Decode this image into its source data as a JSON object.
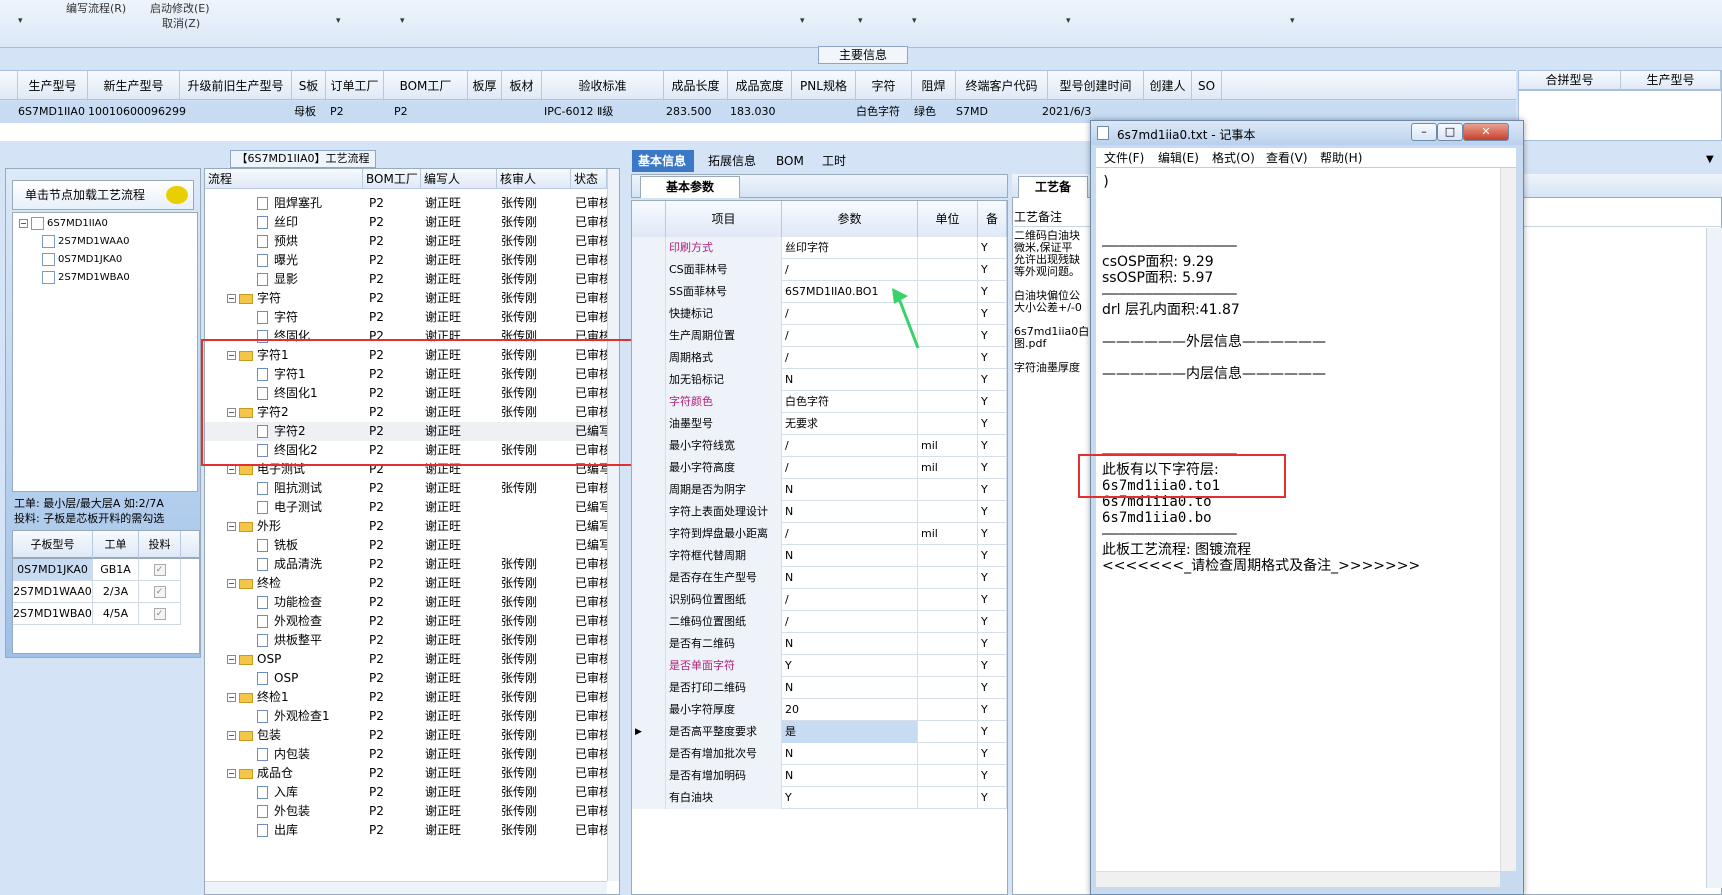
{
  "toolbar": {
    "menu1": "编写流程(R)",
    "menu2": "启动修改(E)",
    "menu3": "取消(Z)"
  },
  "main_section": {
    "title": "主要信息",
    "columns": [
      "生产型号",
      "新生产型号",
      "升级前旧生产型号",
      "S板",
      "订单工厂",
      "BOM工厂",
      "板厚",
      "板材",
      "验收标准",
      "成品长度",
      "成品宽度",
      "PNL规格",
      "字符",
      "阻焊",
      "终端客户代码",
      "型号创建时间",
      "创建人",
      "SO"
    ],
    "row": {
      "model": "6S7MD1IIA0",
      "new_model": "10010600096299",
      "sboard": "母板",
      "order_factory": "P2",
      "bom_factory": "P2",
      "standard": "IPC-6012 Ⅱ级",
      "length": "283.500",
      "width": "183.030",
      "char": "白色字符",
      "mask": "绿色",
      "customer": "S7MD",
      "created": "2021/6/3"
    },
    "right_columns": [
      "合拼型号",
      "生产型号"
    ]
  },
  "left_panel": {
    "load_button": "单击节点加载工艺流程",
    "tree": [
      "6S7MD1IIA0",
      "2S7MD1WAA0",
      "0S7MD1JKA0",
      "2S7MD1WBA0"
    ],
    "info_line1": "工单: 最小层/最大层A 如:2/7A",
    "info_line2": "投料: 子板是芯板开料的需勾选",
    "sub_columns": [
      "子板型号",
      "工单",
      "投料"
    ],
    "sub_rows": [
      {
        "model": "0S7MD1JKA0",
        "order": "GB1A",
        "check": "✓"
      },
      {
        "model": "2S7MD1WAA0",
        "order": "2/3A",
        "check": "✓"
      },
      {
        "model": "2S7MD1WBA0",
        "order": "4/5A",
        "check": "✓"
      }
    ]
  },
  "process": {
    "title": "【6S7MD1IIA0】工艺流程",
    "columns": [
      "流程",
      "BOM工厂",
      "编写人",
      "核审人",
      "状态"
    ],
    "rows": [
      {
        "type": "doc",
        "level": 2,
        "name": "阻焊塞孔",
        "bom": "P2",
        "writer": "谢正旺",
        "reviewer": "张传刚",
        "status": "已审核"
      },
      {
        "type": "doc",
        "level": 2,
        "name": "丝印",
        "bom": "P2",
        "writer": "谢正旺",
        "reviewer": "张传刚",
        "status": "已审核"
      },
      {
        "type": "doc",
        "level": 2,
        "name": "预烘",
        "bom": "P2",
        "writer": "谢正旺",
        "reviewer": "张传刚",
        "status": "已审核"
      },
      {
        "type": "doc",
        "level": 2,
        "name": "曝光",
        "bom": "P2",
        "writer": "谢正旺",
        "reviewer": "张传刚",
        "status": "已审核"
      },
      {
        "type": "doc",
        "level": 2,
        "name": "显影",
        "bom": "P2",
        "writer": "谢正旺",
        "reviewer": "张传刚",
        "status": "已审核"
      },
      {
        "type": "folder",
        "level": 1,
        "name": "字符",
        "bom": "P2",
        "writer": "谢正旺",
        "reviewer": "张传刚",
        "status": "已审核"
      },
      {
        "type": "doc",
        "level": 2,
        "name": "字符",
        "bom": "P2",
        "writer": "谢正旺",
        "reviewer": "张传刚",
        "status": "已审核"
      },
      {
        "type": "doc",
        "level": 2,
        "name": "终固化",
        "bom": "P2",
        "writer": "谢正旺",
        "reviewer": "张传刚",
        "status": "已审核"
      },
      {
        "type": "folder",
        "level": 1,
        "name": "字符1",
        "bom": "P2",
        "writer": "谢正旺",
        "reviewer": "张传刚",
        "status": "已审核"
      },
      {
        "type": "doc",
        "level": 2,
        "name": "字符1",
        "bom": "P2",
        "writer": "谢正旺",
        "reviewer": "张传刚",
        "status": "已审核"
      },
      {
        "type": "doc",
        "level": 2,
        "name": "终固化1",
        "bom": "P2",
        "writer": "谢正旺",
        "reviewer": "张传刚",
        "status": "已审核"
      },
      {
        "type": "folder",
        "level": 1,
        "name": "字符2",
        "bom": "P2",
        "writer": "谢正旺",
        "reviewer": "张传刚",
        "status": "已审核"
      },
      {
        "type": "doc",
        "level": 2,
        "name": "字符2",
        "bom": "P2",
        "writer": "谢正旺",
        "reviewer": "",
        "status": "已编写"
      },
      {
        "type": "doc",
        "level": 2,
        "name": "终固化2",
        "bom": "P2",
        "writer": "谢正旺",
        "reviewer": "张传刚",
        "status": "已审核"
      },
      {
        "type": "folder",
        "level": 1,
        "name": "电子测试",
        "bom": "P2",
        "writer": "谢正旺",
        "reviewer": "",
        "status": "已编写"
      },
      {
        "type": "doc",
        "level": 2,
        "name": "阻抗测试",
        "bom": "P2",
        "writer": "谢正旺",
        "reviewer": "张传刚",
        "status": "已审核"
      },
      {
        "type": "doc",
        "level": 2,
        "name": "电子测试",
        "bom": "P2",
        "writer": "谢正旺",
        "reviewer": "",
        "status": "已编写"
      },
      {
        "type": "folder",
        "level": 1,
        "name": "外形",
        "bom": "P2",
        "writer": "谢正旺",
        "reviewer": "",
        "status": "已编写"
      },
      {
        "type": "doc",
        "level": 2,
        "name": "铣板",
        "bom": "P2",
        "writer": "谢正旺",
        "reviewer": "",
        "status": "已编写"
      },
      {
        "type": "doc",
        "level": 2,
        "name": "成品清洗",
        "bom": "P2",
        "writer": "谢正旺",
        "reviewer": "张传刚",
        "status": "已审核"
      },
      {
        "type": "folder",
        "level": 1,
        "name": "终检",
        "bom": "P2",
        "writer": "谢正旺",
        "reviewer": "张传刚",
        "status": "已审核"
      },
      {
        "type": "doc",
        "level": 2,
        "name": "功能检查",
        "bom": "P2",
        "writer": "谢正旺",
        "reviewer": "张传刚",
        "status": "已审核"
      },
      {
        "type": "doc",
        "level": 2,
        "name": "外观检查",
        "bom": "P2",
        "writer": "谢正旺",
        "reviewer": "张传刚",
        "status": "已审核"
      },
      {
        "type": "doc",
        "level": 2,
        "name": "烘板整平",
        "bom": "P2",
        "writer": "谢正旺",
        "reviewer": "张传刚",
        "status": "已审核"
      },
      {
        "type": "folder",
        "level": 1,
        "name": "OSP",
        "bom": "P2",
        "writer": "谢正旺",
        "reviewer": "张传刚",
        "status": "已审核"
      },
      {
        "type": "doc",
        "level": 2,
        "name": "OSP",
        "bom": "P2",
        "writer": "谢正旺",
        "reviewer": "张传刚",
        "status": "已审核"
      },
      {
        "type": "folder",
        "level": 1,
        "name": "终检1",
        "bom": "P2",
        "writer": "谢正旺",
        "reviewer": "张传刚",
        "status": "已审核"
      },
      {
        "type": "doc",
        "level": 2,
        "name": "外观检查1",
        "bom": "P2",
        "writer": "谢正旺",
        "reviewer": "张传刚",
        "status": "已审核"
      },
      {
        "type": "folder",
        "level": 1,
        "name": "包装",
        "bom": "P2",
        "writer": "谢正旺",
        "reviewer": "张传刚",
        "status": "已审核"
      },
      {
        "type": "doc",
        "level": 2,
        "name": "内包装",
        "bom": "P2",
        "writer": "谢正旺",
        "reviewer": "张传刚",
        "status": "已审核"
      },
      {
        "type": "folder",
        "level": 1,
        "name": "成品仓",
        "bom": "P2",
        "writer": "谢正旺",
        "reviewer": "张传刚",
        "status": "已审核"
      },
      {
        "type": "doc",
        "level": 2,
        "name": "入库",
        "bom": "P2",
        "writer": "谢正旺",
        "reviewer": "张传刚",
        "status": "已审核"
      },
      {
        "type": "doc",
        "level": 2,
        "name": "外包装",
        "bom": "P2",
        "writer": "谢正旺",
        "reviewer": "张传刚",
        "status": "已审核"
      },
      {
        "type": "doc",
        "level": 2,
        "name": "出库",
        "bom": "P2",
        "writer": "谢正旺",
        "reviewer": "张传刚",
        "status": "已审核"
      }
    ]
  },
  "tabs": [
    "基本信息",
    "拓展信息",
    "BOM",
    "工时"
  ],
  "params": {
    "tab_label": "基本参数",
    "columns": [
      "项目",
      "参数",
      "单位",
      "备"
    ],
    "rows": [
      {
        "item": "印刷方式",
        "value": "丝印字符",
        "unit": "",
        "flag": "Y",
        "magenta": true
      },
      {
        "item": "CS面菲林号",
        "value": "/",
        "unit": "",
        "flag": "Y"
      },
      {
        "item": "SS面菲林号",
        "value": "6S7MD1IIA0.BO1",
        "unit": "",
        "flag": "Y"
      },
      {
        "item": "快捷标记",
        "value": "/",
        "unit": "",
        "flag": "Y"
      },
      {
        "item": "生产周期位置",
        "value": "/",
        "unit": "",
        "flag": "Y"
      },
      {
        "item": "周期格式",
        "value": "/",
        "unit": "",
        "flag": "Y"
      },
      {
        "item": "加无铅标记",
        "value": "N",
        "unit": "",
        "flag": "Y"
      },
      {
        "item": "字符颜色",
        "value": "白色字符",
        "unit": "",
        "flag": "Y",
        "magenta": true
      },
      {
        "item": "油墨型号",
        "value": "无要求",
        "unit": "",
        "flag": "Y"
      },
      {
        "item": "最小字符线宽",
        "value": "/",
        "unit": "mil",
        "flag": "Y"
      },
      {
        "item": "最小字符高度",
        "value": "/",
        "unit": "mil",
        "flag": "Y"
      },
      {
        "item": "周期是否为阴字",
        "value": "N",
        "unit": "",
        "flag": "Y"
      },
      {
        "item": "字符上表面处理设计",
        "value": "N",
        "unit": "",
        "flag": "Y"
      },
      {
        "item": "字符到焊盘最小距离",
        "value": "/",
        "unit": "mil",
        "flag": "Y"
      },
      {
        "item": "字符框代替周期",
        "value": "N",
        "unit": "",
        "flag": "Y"
      },
      {
        "item": "是否存在生产型号",
        "value": "N",
        "unit": "",
        "flag": "Y"
      },
      {
        "item": "识别码位置图纸",
        "value": "/",
        "unit": "",
        "flag": "Y"
      },
      {
        "item": "二维码位置图纸",
        "value": "/",
        "unit": "",
        "flag": "Y"
      },
      {
        "item": "是否有二维码",
        "value": "N",
        "unit": "",
        "flag": "Y"
      },
      {
        "item": "是否单面字符",
        "value": "Y",
        "unit": "",
        "flag": "Y",
        "magenta": true
      },
      {
        "item": "是否打印二维码",
        "value": "N",
        "unit": "",
        "flag": "Y"
      },
      {
        "item": "最小字符厚度",
        "value": "20",
        "unit": "",
        "flag": "Y"
      },
      {
        "item": "是否高平整度要求",
        "value": "是",
        "unit": "",
        "flag": "Y",
        "selected": true
      },
      {
        "item": "是否有增加批次号",
        "value": "N",
        "unit": "",
        "flag": "Y"
      },
      {
        "item": "是否有增加明码",
        "value": "N",
        "unit": "",
        "flag": "Y"
      },
      {
        "item": "有白油块",
        "value": "Y",
        "unit": "",
        "flag": "Y"
      }
    ]
  },
  "notes": {
    "tab_label": "工艺备",
    "header": "工艺备注",
    "lines": [
      "二维码白油块",
      "微米,保证平",
      "允许出现残缺",
      "等外观问题。",
      "",
      "白油块偏位公",
      "大小公差+/-0",
      "",
      "6s7md1iia0白",
      "图.pdf",
      "",
      "字符油墨厚度"
    ]
  },
  "notepad": {
    "title": "6s7md1iia0.txt - 记事本",
    "menu": [
      "文件(F)",
      "编辑(E)",
      "格式(O)",
      "查看(V)",
      "帮助(H)"
    ],
    "lines": [
      ")",
      "",
      "",
      "",
      "————————————————",
      "csOSP面积: 9.29",
      "ssOSP面积: 5.97",
      "————————————————",
      "drl          层孔内面积:41.87",
      "",
      "——————外层信息——————",
      "",
      "——————内层信息——————",
      "",
      "",
      "",
      "",
      "————————————————",
      "此板有以下字符层:",
      "6s7md1iia0.to1",
      "6s7md1iia0.to",
      "6s7md1iia0.bo",
      "————————————————",
      "此板工艺流程: 图镀流程",
      "<<<<<<<_请检查周期格式及备注_>>>>>>>"
    ]
  }
}
